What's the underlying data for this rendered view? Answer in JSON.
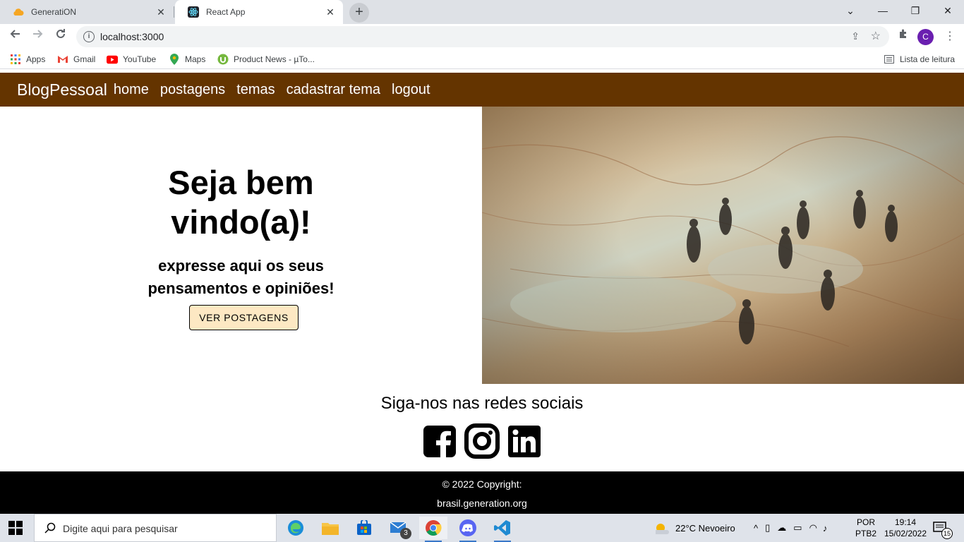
{
  "browser": {
    "tabs": [
      {
        "title": "GeneratiON",
        "icon": "cloud-icon"
      },
      {
        "title": "React App",
        "icon": "react-icon"
      }
    ],
    "address": "localhost:3000",
    "profile_initial": "C",
    "bookmarks": [
      "Apps",
      "Gmail",
      "YouTube",
      "Maps",
      "Product News - µTo..."
    ],
    "reading_list": "Lista de leitura"
  },
  "app": {
    "brand": "BlogPessoal",
    "nav": [
      "home",
      "postagens",
      "temas",
      "cadastrar tema",
      "logout"
    ],
    "nav_color": "#643400",
    "hero_title_line1": "Seja bem",
    "hero_title_line2": "vindo(a)!",
    "hero_sub_line1": "expresse aqui os seus",
    "hero_sub_line2": "pensamentos e opiniões!",
    "hero_button": "VER POSTAGENS",
    "social_title": "Siga-nos nas redes sociais",
    "social_icons": [
      "facebook-icon",
      "instagram-icon",
      "linkedin-icon"
    ],
    "footer_copyright": "© 2022 Copyright:",
    "footer_link": "brasil.generation.org"
  },
  "taskbar": {
    "search_placeholder": "Digite aqui para pesquisar",
    "mail_badge": "3",
    "weather": "22°C  Nevoeiro",
    "lang1": "POR",
    "lang2": "PTB2",
    "time": "19:14",
    "date": "15/02/2022",
    "notifications": "15"
  }
}
